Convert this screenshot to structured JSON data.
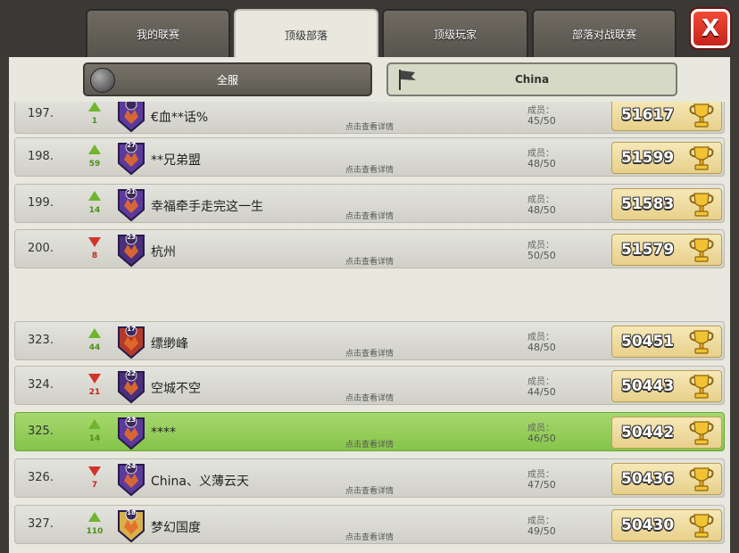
{
  "tabs": [
    {
      "label": "我的联赛",
      "active": false
    },
    {
      "label": "顶级部落",
      "active": true
    },
    {
      "label": "顶级玩家",
      "active": false
    },
    {
      "label": "部落对战联赛",
      "active": false
    }
  ],
  "close_label": "X",
  "subtabs": {
    "global": "全服",
    "local": "China"
  },
  "member_label": "成员：",
  "detail_label": "点击查看详情",
  "rows": [
    {
      "rank": "197.",
      "dir": "up",
      "change": "1",
      "level": "",
      "badge_color": "#5b3a9b",
      "name": "€血**话%",
      "members": "45/50",
      "trophies": "51617",
      "highlight": false
    },
    {
      "rank": "198.",
      "dir": "up",
      "change": "59",
      "level": "27",
      "badge_color": "#5b3a9b",
      "name": "**兄弟盟",
      "members": "48/50",
      "trophies": "51599",
      "highlight": false
    },
    {
      "rank": "199.",
      "dir": "up",
      "change": "14",
      "level": "21",
      "badge_color": "#5b3a9b",
      "name": "幸福牵手走完这一生",
      "members": "48/50",
      "trophies": "51583",
      "highlight": false
    },
    {
      "rank": "200.",
      "dir": "down",
      "change": "8",
      "level": "23",
      "badge_color": "#4a2f7c",
      "name": "杭州",
      "members": "50/50",
      "trophies": "51579",
      "highlight": false
    },
    {
      "rank": "323.",
      "dir": "up",
      "change": "44",
      "level": "17",
      "badge_color": "#b23a2a",
      "name": "缥缈峰",
      "members": "48/50",
      "trophies": "50451",
      "highlight": false
    },
    {
      "rank": "324.",
      "dir": "down",
      "change": "21",
      "level": "22",
      "badge_color": "#4a2f7c",
      "name": "空城不空",
      "members": "44/50",
      "trophies": "50443",
      "highlight": false
    },
    {
      "rank": "325.",
      "dir": "up",
      "change": "14",
      "level": "23",
      "badge_color": "#5b3a9b",
      "name": "****",
      "members": "46/50",
      "trophies": "50442",
      "highlight": true
    },
    {
      "rank": "326.",
      "dir": "down",
      "change": "7",
      "level": "24",
      "badge_color": "#5b3a9b",
      "name": "China、义薄云天",
      "members": "47/50",
      "trophies": "50436",
      "highlight": false
    },
    {
      "rank": "327.",
      "dir": "up",
      "change": "110",
      "level": "18",
      "badge_color": "#d8b04a",
      "name": "梦幻国度",
      "members": "49/50",
      "trophies": "50430",
      "highlight": false
    }
  ]
}
